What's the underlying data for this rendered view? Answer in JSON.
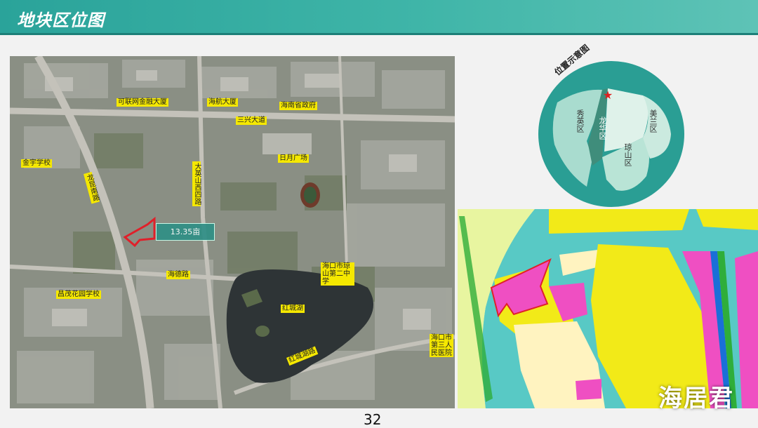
{
  "header": {
    "title": "地块区位图"
  },
  "satellite_labels": {
    "hualian": "可联网金融大厦",
    "hangtian": "海航大厦",
    "government": "海南省政府",
    "sanxing": "三兴大道",
    "riyue": "日月广场",
    "jinyu": "金宇学校",
    "longkun": "龙昆南路",
    "dayingshan": "大英山西四路",
    "area": "13.35亩",
    "haide": "海德路",
    "changmao": "昌茂花园学校",
    "school": "海口市琼山第二中学",
    "hongcheng_lake": "红城湖",
    "hongcheng_road": "红城湖路",
    "hospital": "海口市第三人民医院"
  },
  "location_map": {
    "title": "位置示意图",
    "districts": [
      "秀英区",
      "龙华区",
      "美兰区",
      "琼山区"
    ]
  },
  "page_number": "32",
  "watermark": "海居君"
}
